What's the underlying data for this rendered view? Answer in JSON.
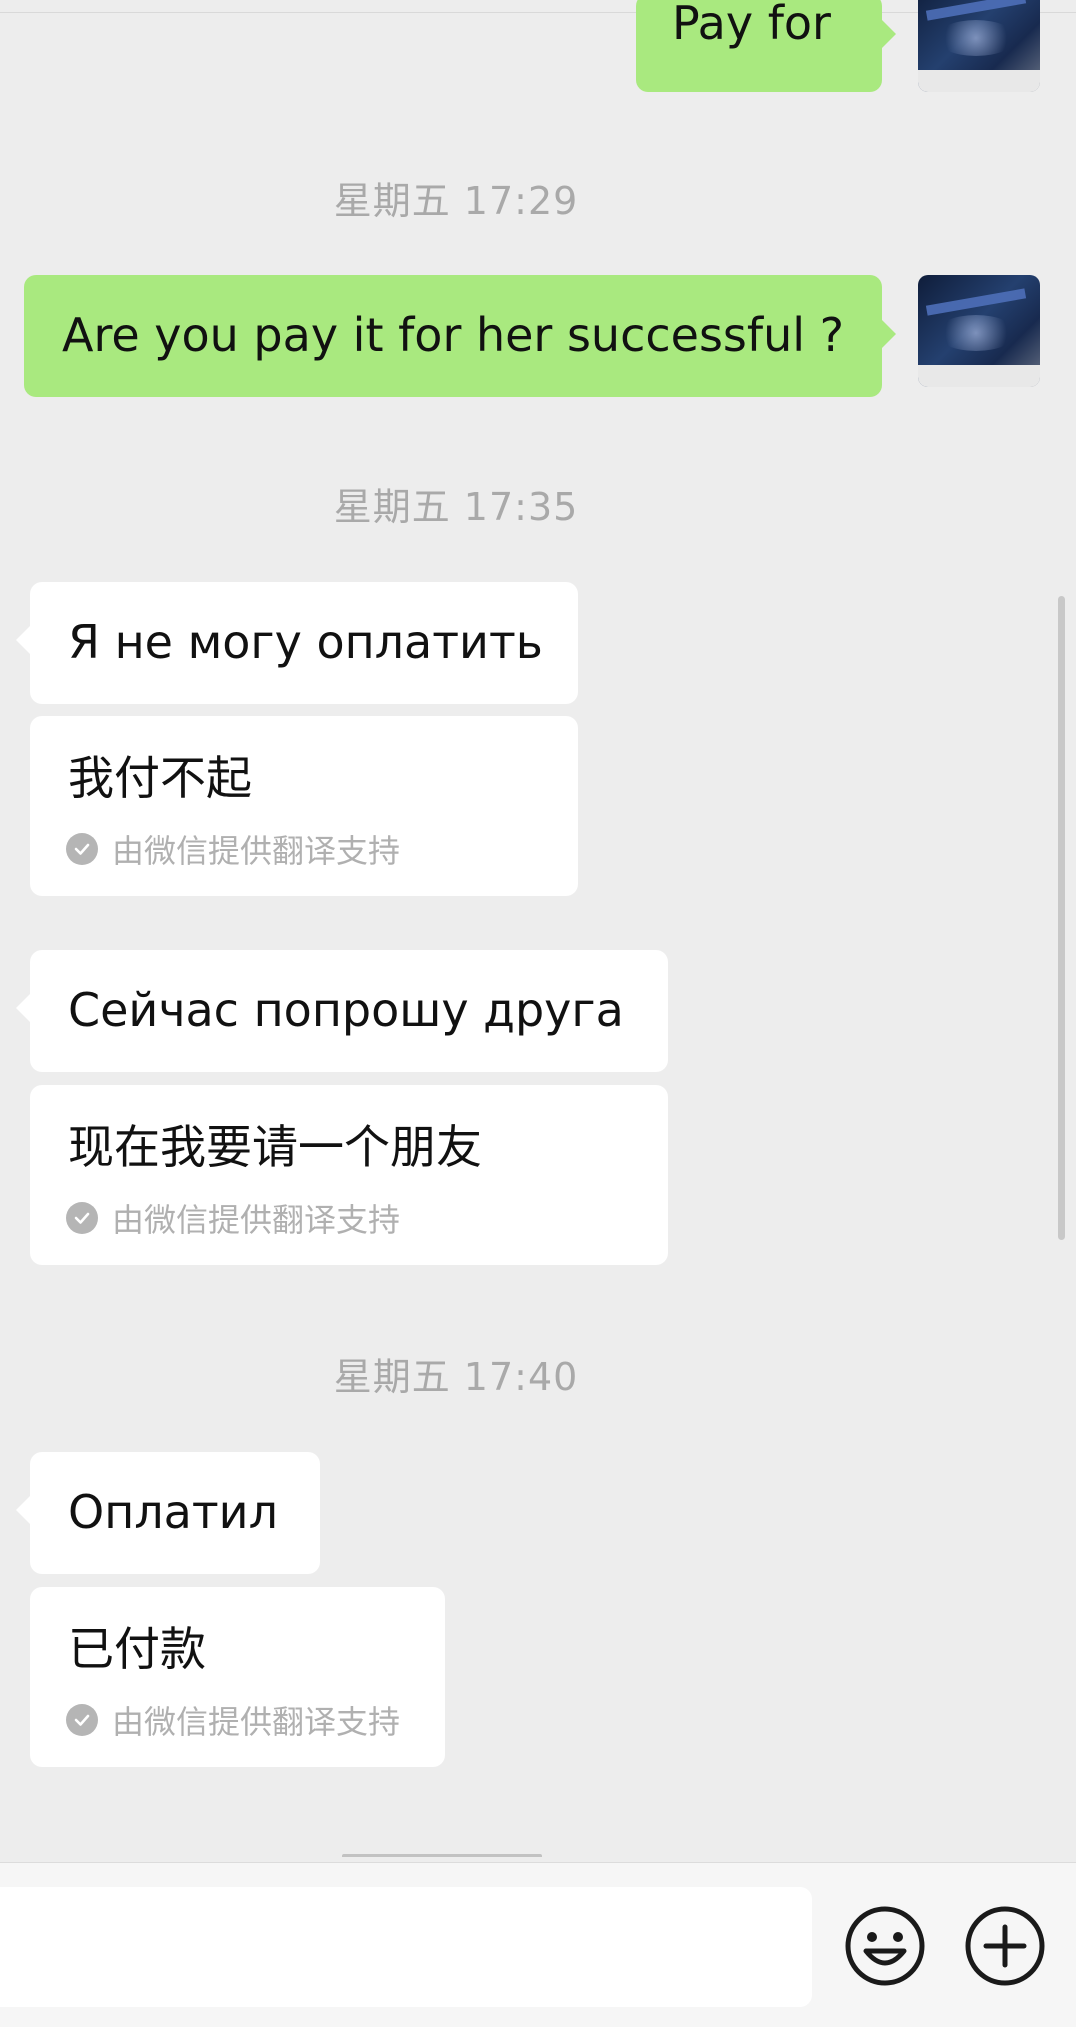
{
  "messages": {
    "m0": {
      "text": "Pay for"
    },
    "ts1": "星期五 17:29",
    "m1": {
      "text": "Are you pay it for her successful ?"
    },
    "ts2": "星期五 17:35",
    "m2": {
      "text": "Я не могу оплатить",
      "translation": "我付不起"
    },
    "m3": {
      "text": "Сейчас попрошу друга",
      "translation": "现在我要请一个朋友"
    },
    "ts3": "星期五 17:40",
    "m4": {
      "text": "Оплатил",
      "translation": "已付款"
    }
  },
  "translation_note": "由微信提供翻译支持",
  "icons": {
    "avatar": "avatar-image",
    "check": "check-circle-icon",
    "emoji": "emoji-icon",
    "plus": "plus-icon"
  },
  "colors": {
    "sent_bubble": "#a9e97f",
    "recv_bubble": "#ffffff",
    "background": "#ededed"
  }
}
